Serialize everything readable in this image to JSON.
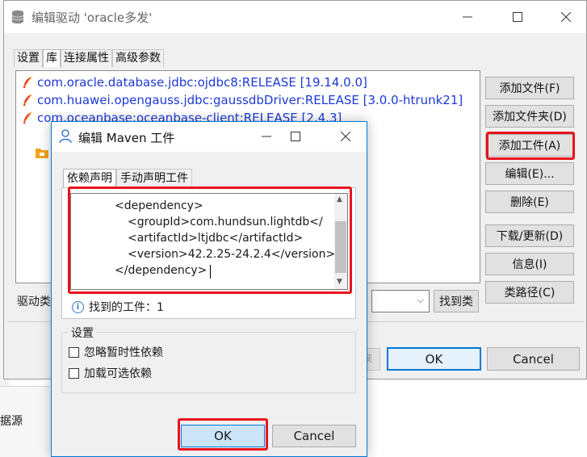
{
  "background": {
    "bottom_label": "据源"
  },
  "main_dialog": {
    "title": "编辑驱动 'oracle多发'",
    "tabs": [
      "设置",
      "库",
      "连接属性",
      "高级参数"
    ],
    "libraries": [
      "com.oracle.database.jdbc:ojdbc8:RELEASE [19.14.0.0]",
      "com.huawei.opengauss.jdbc:gaussdbDriver:RELEASE [3.0.0-htrunk21]",
      "com.oceanbase:oceanbase-client:RELEASE [2.4.3]"
    ],
    "side_buttons": [
      "添加文件(F)",
      "添加文件夹(D)",
      "添加工件(A)",
      "编辑(E)...",
      "删除(E)",
      "下载/更新(D)",
      "信息(I)",
      "类路径(C)"
    ],
    "driver_label": "驱动类",
    "find_button": "找到类",
    "faded_button": "恢",
    "ok_button": "OK",
    "cancel_button": "Cancel"
  },
  "maven_dialog": {
    "title": "编辑 Maven 工件",
    "tabs": [
      "依赖声明",
      "手动声明工件"
    ],
    "code": [
      "<dependency>",
      "<groupId>com.hundsun.lightdb</",
      "<artifactId>ltjdbc</artifactId>",
      "<version>42.2.25-24.2.4</version>",
      "</dependency>"
    ],
    "found_text": "找到的工件：1",
    "settings_title": "设置",
    "options": [
      "忽略暂时性依赖",
      "加载可选依赖"
    ],
    "ok_button": "OK",
    "cancel_button": "Cancel"
  },
  "colors": {
    "highlight": "#e8121c",
    "link": "#1c39d6",
    "accent": "#0078d7"
  }
}
